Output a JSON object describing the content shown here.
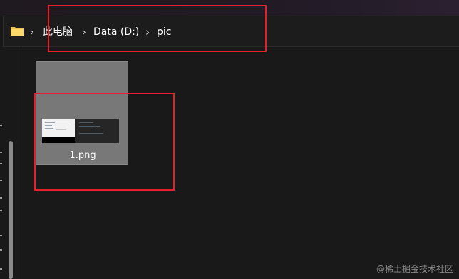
{
  "breadcrumb": {
    "items": [
      {
        "label": "此电脑"
      },
      {
        "label": "Data (D:)"
      },
      {
        "label": "pic"
      }
    ],
    "separator": "›"
  },
  "files": [
    {
      "name": "1.png",
      "type": "image"
    }
  ],
  "watermark": "@稀土掘金技术社区",
  "colors": {
    "annotation": "#e81e2a",
    "selected_tile": "#787878",
    "background": "#191919"
  }
}
